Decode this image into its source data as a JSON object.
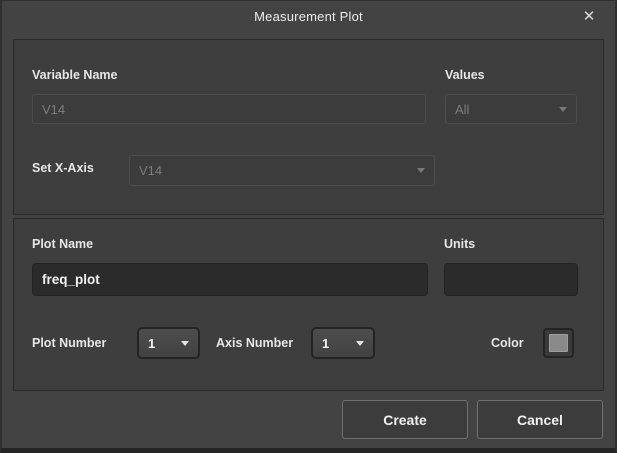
{
  "dialog": {
    "title": "Measurement Plot",
    "close_icon": "✕"
  },
  "variable_section": {
    "variable_name_label": "Variable Name",
    "variable_name_value": "V14",
    "values_label": "Values",
    "values_selected": "All",
    "set_x_axis_label": "Set X-Axis",
    "set_x_axis_selected": "V14"
  },
  "plot_section": {
    "plot_name_label": "Plot Name",
    "plot_name_value": "freq_plot",
    "units_label": "Units",
    "units_value": "",
    "plot_number_label": "Plot Number",
    "plot_number_selected": "1",
    "axis_number_label": "Axis Number",
    "axis_number_selected": "1",
    "color_label": "Color",
    "color_value": "#8a8a8a"
  },
  "footer": {
    "create_label": "Create",
    "cancel_label": "Cancel"
  }
}
